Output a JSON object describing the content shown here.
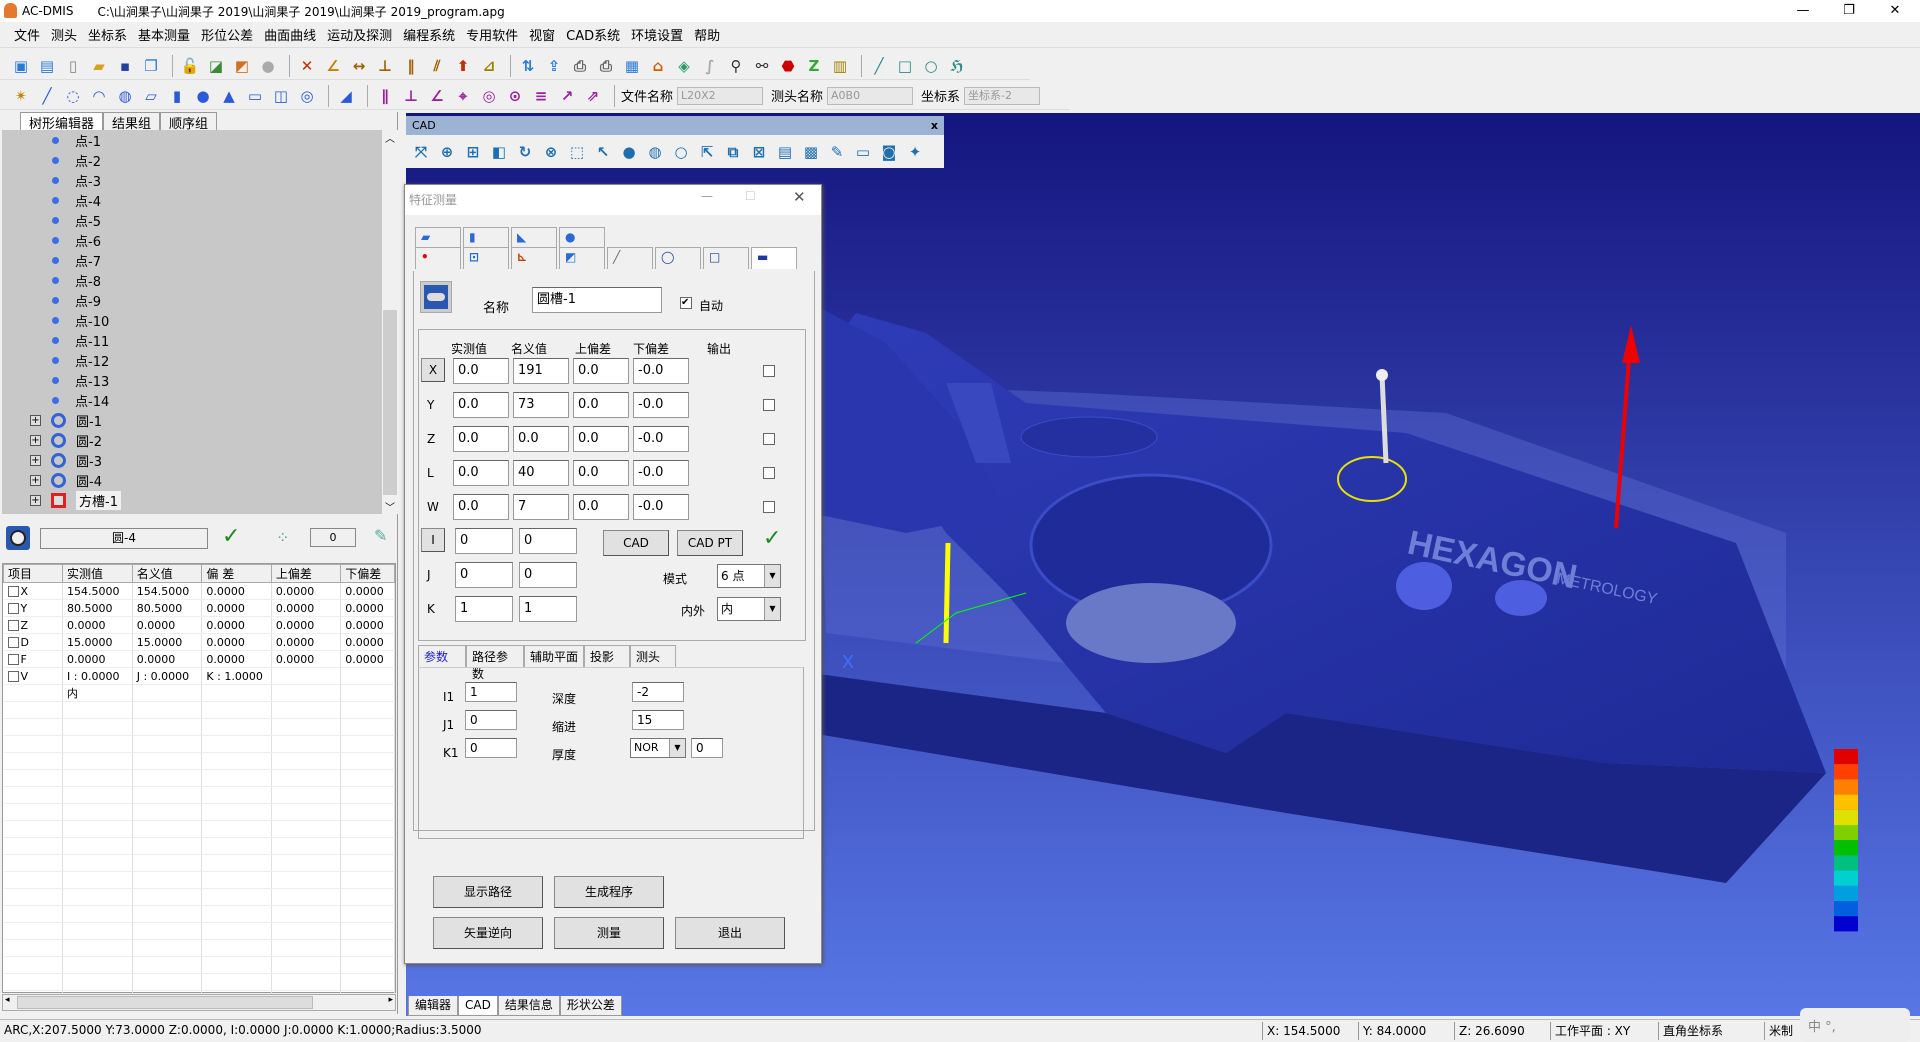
{
  "window": {
    "app": "AC-DMIS",
    "path": "C:\\山涧果子\\山涧果子 2019\\山涧果子 2019\\山涧果子 2019_program.apg",
    "minimize": "—",
    "restore": "❐",
    "close": "✕"
  },
  "menu": [
    "文件",
    "测头",
    "坐标系",
    "基本测量",
    "形位公差",
    "曲面曲线",
    "运动及探测",
    "编程系统",
    "专用软件",
    "视窗",
    "CAD系统",
    "环境设置",
    "帮助"
  ],
  "toolbar": {
    "file_name_label": "文件名称",
    "file_name_value": "L20X2",
    "probe_name_label": "测头名称",
    "probe_name_value": "A0B0",
    "coord_label": "坐标系",
    "coord_value": "坐标系-2"
  },
  "left": {
    "tabs": [
      "树形编辑器",
      "结果组",
      "顺序组"
    ],
    "tree": [
      {
        "label": "点-1",
        "type": "point"
      },
      {
        "label": "点-2",
        "type": "point"
      },
      {
        "label": "点-3",
        "type": "point"
      },
      {
        "label": "点-4",
        "type": "point"
      },
      {
        "label": "点-5",
        "type": "point"
      },
      {
        "label": "点-6",
        "type": "point"
      },
      {
        "label": "点-7",
        "type": "point"
      },
      {
        "label": "点-8",
        "type": "point"
      },
      {
        "label": "点-9",
        "type": "point"
      },
      {
        "label": "点-10",
        "type": "point"
      },
      {
        "label": "点-11",
        "type": "point"
      },
      {
        "label": "点-12",
        "type": "point"
      },
      {
        "label": "点-13",
        "type": "point"
      },
      {
        "label": "点-14",
        "type": "point"
      },
      {
        "label": "圆-1",
        "type": "circle"
      },
      {
        "label": "圆-2",
        "type": "circle"
      },
      {
        "label": "圆-3",
        "type": "circle"
      },
      {
        "label": "圆-4",
        "type": "circle"
      },
      {
        "label": "方槽-1",
        "type": "slot",
        "selected": true
      }
    ],
    "feature_name": "圆-4",
    "point_count": "0",
    "columns": [
      "项目",
      "实测值",
      "名义值",
      "偏 差",
      "上偏差",
      "下偏差"
    ],
    "rows": [
      [
        "X",
        "154.5000",
        "154.5000",
        "0.0000",
        "0.0000",
        "0.0000"
      ],
      [
        "Y",
        "80.5000",
        "80.5000",
        "0.0000",
        "0.0000",
        "0.0000"
      ],
      [
        "Z",
        "0.0000",
        "0.0000",
        "0.0000",
        "0.0000",
        "0.0000"
      ],
      [
        "D",
        "15.0000",
        "15.0000",
        "0.0000",
        "0.0000",
        "0.0000"
      ],
      [
        "F",
        "0.0000",
        "0.0000",
        "0.0000",
        "0.0000",
        "0.0000"
      ],
      [
        "V",
        "I : 0.0000",
        "J : 0.0000",
        "K : 1.0000",
        "",
        ""
      ],
      [
        "",
        "内",
        "",
        "",
        "",
        ""
      ]
    ]
  },
  "cad": {
    "title": "CAD",
    "close": "x",
    "logo_text": "HEXAGON",
    "logo_sub": "METROLOGY",
    "axis_label": "X",
    "bottom_tabs": [
      "编辑器",
      "CAD",
      "结果信息",
      "形状公差"
    ]
  },
  "dialog": {
    "title": "特征测量",
    "name_label": "名称",
    "name_value": "圆槽-1",
    "auto_label": "自动",
    "auto_checked": true,
    "headers": [
      "实测值",
      "名义值",
      "上偏差",
      "下偏差",
      "输出"
    ],
    "rows": [
      {
        "axis": "X",
        "actual": "0.0",
        "nominal": "191",
        "upper": "0.0",
        "lower": "-0.0"
      },
      {
        "axis": "Y",
        "actual": "0.0",
        "nominal": "73",
        "upper": "0.0",
        "lower": "-0.0"
      },
      {
        "axis": "Z",
        "actual": "0.0",
        "nominal": "0.0",
        "upper": "0.0",
        "lower": "-0.0"
      },
      {
        "axis": "L",
        "actual": "0.0",
        "nominal": "40",
        "upper": "0.0",
        "lower": "-0.0"
      },
      {
        "axis": "W",
        "actual": "0.0",
        "nominal": "7",
        "upper": "0.0",
        "lower": "-0.0"
      }
    ],
    "vec": [
      {
        "axis": "I",
        "a": "0",
        "b": "0"
      },
      {
        "axis": "J",
        "a": "0",
        "b": "0"
      },
      {
        "axis": "K",
        "a": "1",
        "b": "1"
      }
    ],
    "cad_btn": "CAD",
    "cadpt_btn": "CAD PT",
    "mode_label": "模式",
    "mode_value": "6 点",
    "inout_label": "内外",
    "inout_value": "内",
    "tabs": [
      "参数",
      "路径参数",
      "辅助平面",
      "投影",
      "测头"
    ],
    "params": {
      "i1_label": "I1",
      "i1": "1",
      "j1_label": "J1",
      "j1": "0",
      "k1_label": "K1",
      "k1": "0",
      "depth_label": "深度",
      "depth": "-2",
      "indent_label": "缩进",
      "indent": "15",
      "thick_label": "厚度",
      "thick_mode": "NOR",
      "thick": "0"
    },
    "buttons": {
      "show_path": "显示路径",
      "gen_prog": "生成程序",
      "reverse": "矢量逆向",
      "measure": "测量",
      "exit": "退出"
    }
  },
  "status": {
    "message": "ARC,X:207.5000 Y:73.0000 Z:0.0000, I:0.0000 J:0.0000 K:1.0000;Radius:3.5000",
    "x": "X: 154.5000",
    "y": "Y: 84.0000",
    "z": "Z: 26.6090",
    "plane": "工作平面 : XY",
    "coord": "直角坐标系",
    "unit": "米制",
    "ime": "中 °,"
  },
  "colors": {
    "cad_bg_top": "#1a1a8c",
    "cad_bg_bottom": "#4a6adf",
    "part": "#2633a6",
    "accent_check": "#1e8a1e",
    "colorbar": [
      "#e00000",
      "#ff4000",
      "#ff8000",
      "#ffc000",
      "#e0e000",
      "#80d000",
      "#00c000",
      "#00c080",
      "#00d0d0",
      "#00a0e0",
      "#0060e0",
      "#0000d0"
    ]
  }
}
